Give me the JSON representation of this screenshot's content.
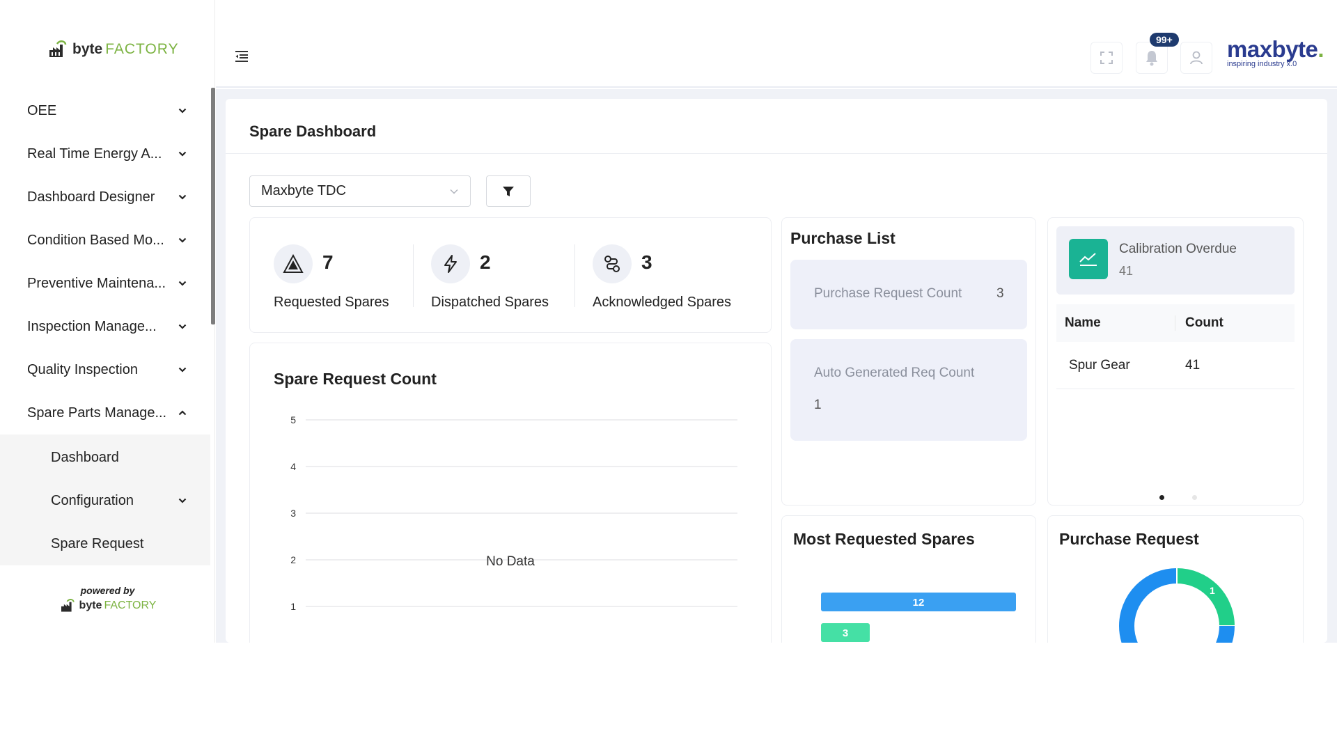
{
  "sidebar": {
    "logo": {
      "part1": "byte",
      "part2": "FACTORY"
    },
    "items": [
      {
        "label": "OEE"
      },
      {
        "label": "Real Time Energy A..."
      },
      {
        "label": "Dashboard Designer"
      },
      {
        "label": "Condition Based Mo..."
      },
      {
        "label": "Preventive Maintena..."
      },
      {
        "label": "Inspection Manage..."
      },
      {
        "label": "Quality Inspection"
      },
      {
        "label": "Spare Parts Manage..."
      }
    ],
    "subitems": [
      {
        "label": "Dashboard"
      },
      {
        "label": "Configuration"
      },
      {
        "label": "Spare Request"
      }
    ],
    "powered_by": "powered by"
  },
  "header": {
    "notification_count": "99+",
    "brand": {
      "name": "maxbyte",
      "dot": ".",
      "tagline": "inspiring industry x.0"
    },
    "icons": [
      "fullscreen-icon",
      "bell-icon",
      "user-icon"
    ]
  },
  "page": {
    "title": "Spare Dashboard",
    "plant_select": "Maxbyte TDC"
  },
  "stats": [
    {
      "value": "7",
      "label": "Requested Spares",
      "icon": "triangle-icon"
    },
    {
      "value": "2",
      "label": "Dispatched Spares",
      "icon": "bolt-icon"
    },
    {
      "value": "3",
      "label": "Acknowledged Spares",
      "icon": "route-icon"
    }
  ],
  "spare_request_count": {
    "title": "Spare Request Count",
    "no_data": "No Data"
  },
  "purchase_list": {
    "title": "Purchase List",
    "request_count_label": "Purchase Request Count",
    "request_count_value": "3",
    "auto_label": "Auto Generated Req Count",
    "auto_value": "1"
  },
  "calibration": {
    "title": "Calibration Overdue",
    "count": "41",
    "columns": [
      "Name",
      "Count"
    ],
    "rows": [
      {
        "name": "Spur Gear",
        "count": "41"
      }
    ]
  },
  "most_requested": {
    "title": "Most Requested Spares"
  },
  "purchase_request": {
    "title": "Purchase Request"
  },
  "colors": {
    "accent_green": "#1ab394",
    "bar_blue": "#3aa0f2",
    "bar_green": "#45e0a5",
    "donut_blue": "#1e8ef0",
    "donut_green": "#21cf89"
  },
  "chart_data": [
    {
      "type": "line",
      "title": "Spare Request Count",
      "y_ticks": [
        5,
        4,
        3,
        2,
        1
      ],
      "series": [],
      "annotation": "No Data",
      "grid": true
    },
    {
      "type": "bar",
      "orientation": "horizontal",
      "title": "Most Requested Spares",
      "values": [
        12,
        3
      ],
      "colors": [
        "#3aa0f2",
        "#45e0a5"
      ]
    },
    {
      "type": "pie",
      "title": "Purchase Request",
      "values": [
        1,
        3
      ],
      "labels": [
        "1",
        ""
      ],
      "colors": [
        "#21cf89",
        "#1e8ef0"
      ]
    }
  ]
}
